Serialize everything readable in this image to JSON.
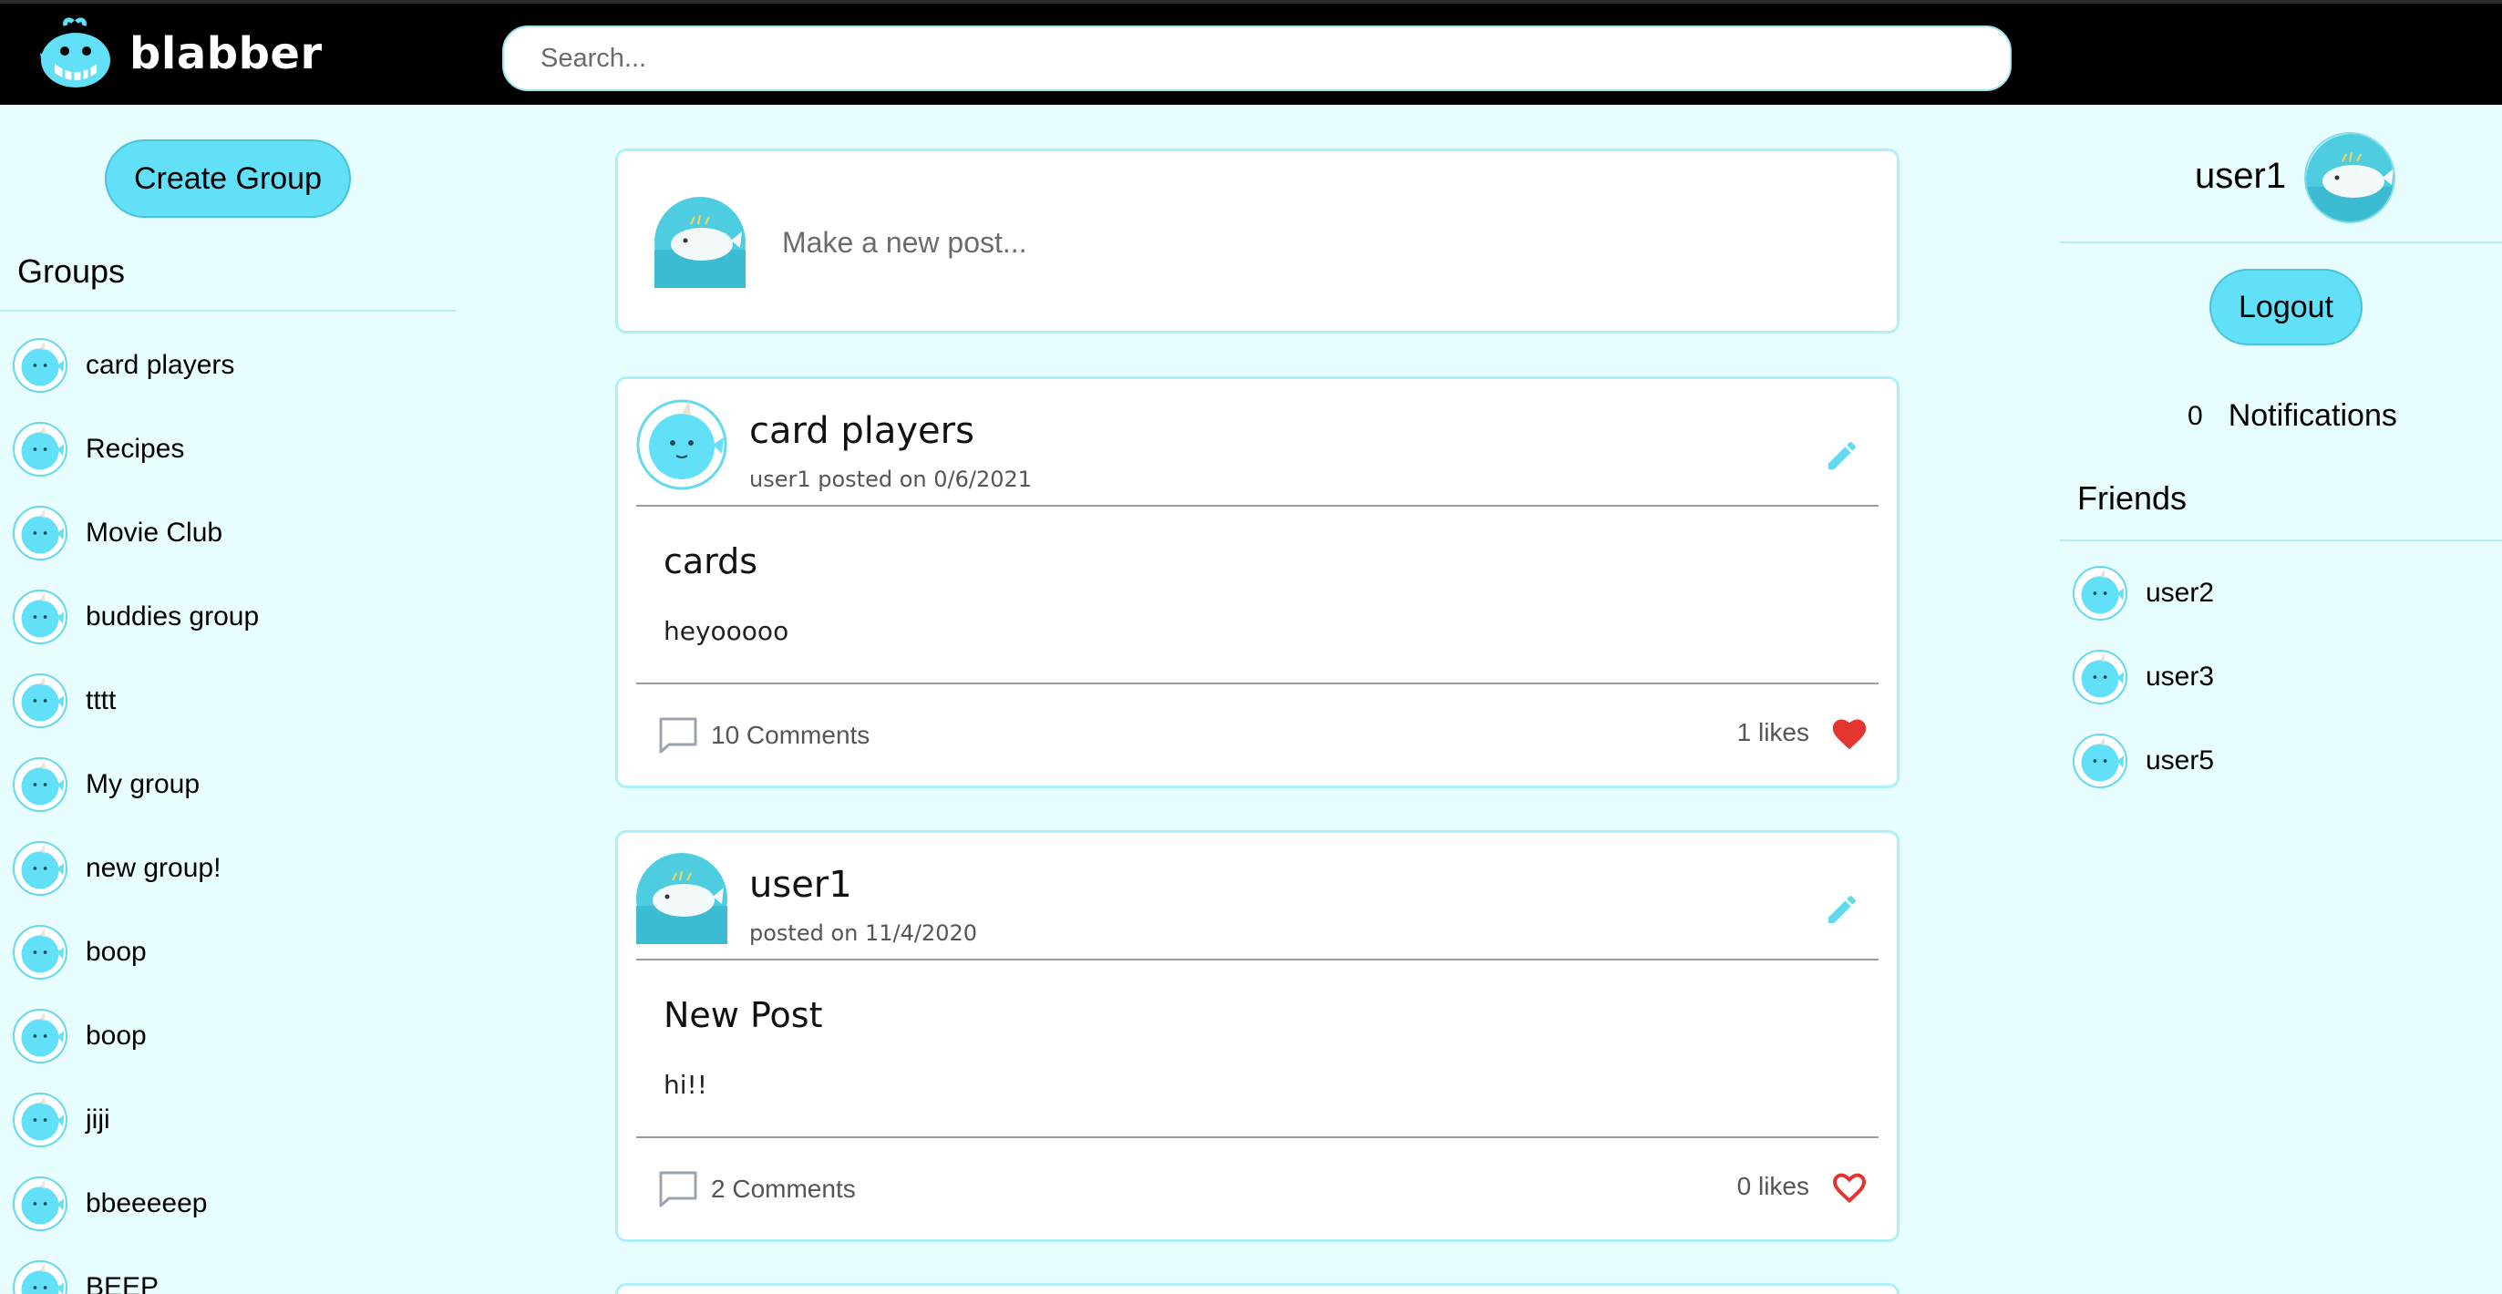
{
  "app": {
    "name": "blabber",
    "logo_icon": "whale-logo-icon"
  },
  "search": {
    "placeholder": "Search..."
  },
  "left_sidebar": {
    "create_group_label": "Create Group",
    "groups_title": "Groups",
    "groups": [
      {
        "label": "card players"
      },
      {
        "label": "Recipes"
      },
      {
        "label": "Movie Club"
      },
      {
        "label": "buddies group"
      },
      {
        "label": "tttt"
      },
      {
        "label": "My group"
      },
      {
        "label": "new group!"
      },
      {
        "label": "boop"
      },
      {
        "label": "boop"
      },
      {
        "label": "jiji"
      },
      {
        "label": "bbeeeeep"
      },
      {
        "label": "BEEP"
      }
    ]
  },
  "composer": {
    "placeholder": "Make a new post..."
  },
  "posts": [
    {
      "title": "card players",
      "meta": "user1 posted on 0/6/2021",
      "body_title": "cards",
      "body_text": "heyooooo",
      "comments": "10 Comments",
      "likes": "1 likes",
      "liked": true
    },
    {
      "title": "user1",
      "meta": "posted on 11/4/2020",
      "body_title": "New Post",
      "body_text": "hi!!",
      "comments": "2 Comments",
      "likes": "0 likes",
      "liked": false
    }
  ],
  "right_sidebar": {
    "username": "user1",
    "logout_label": "Logout",
    "notifications_count": "0",
    "notifications_label": "Notifications",
    "friends_title": "Friends",
    "friends": [
      {
        "label": "user2"
      },
      {
        "label": "user3"
      },
      {
        "label": "user5"
      }
    ]
  },
  "colors": {
    "accent": "#62e0f7",
    "background": "#e8fdfe",
    "header": "#000000",
    "like_red": "#e3342f",
    "edit_icon": "#62d9ee"
  }
}
